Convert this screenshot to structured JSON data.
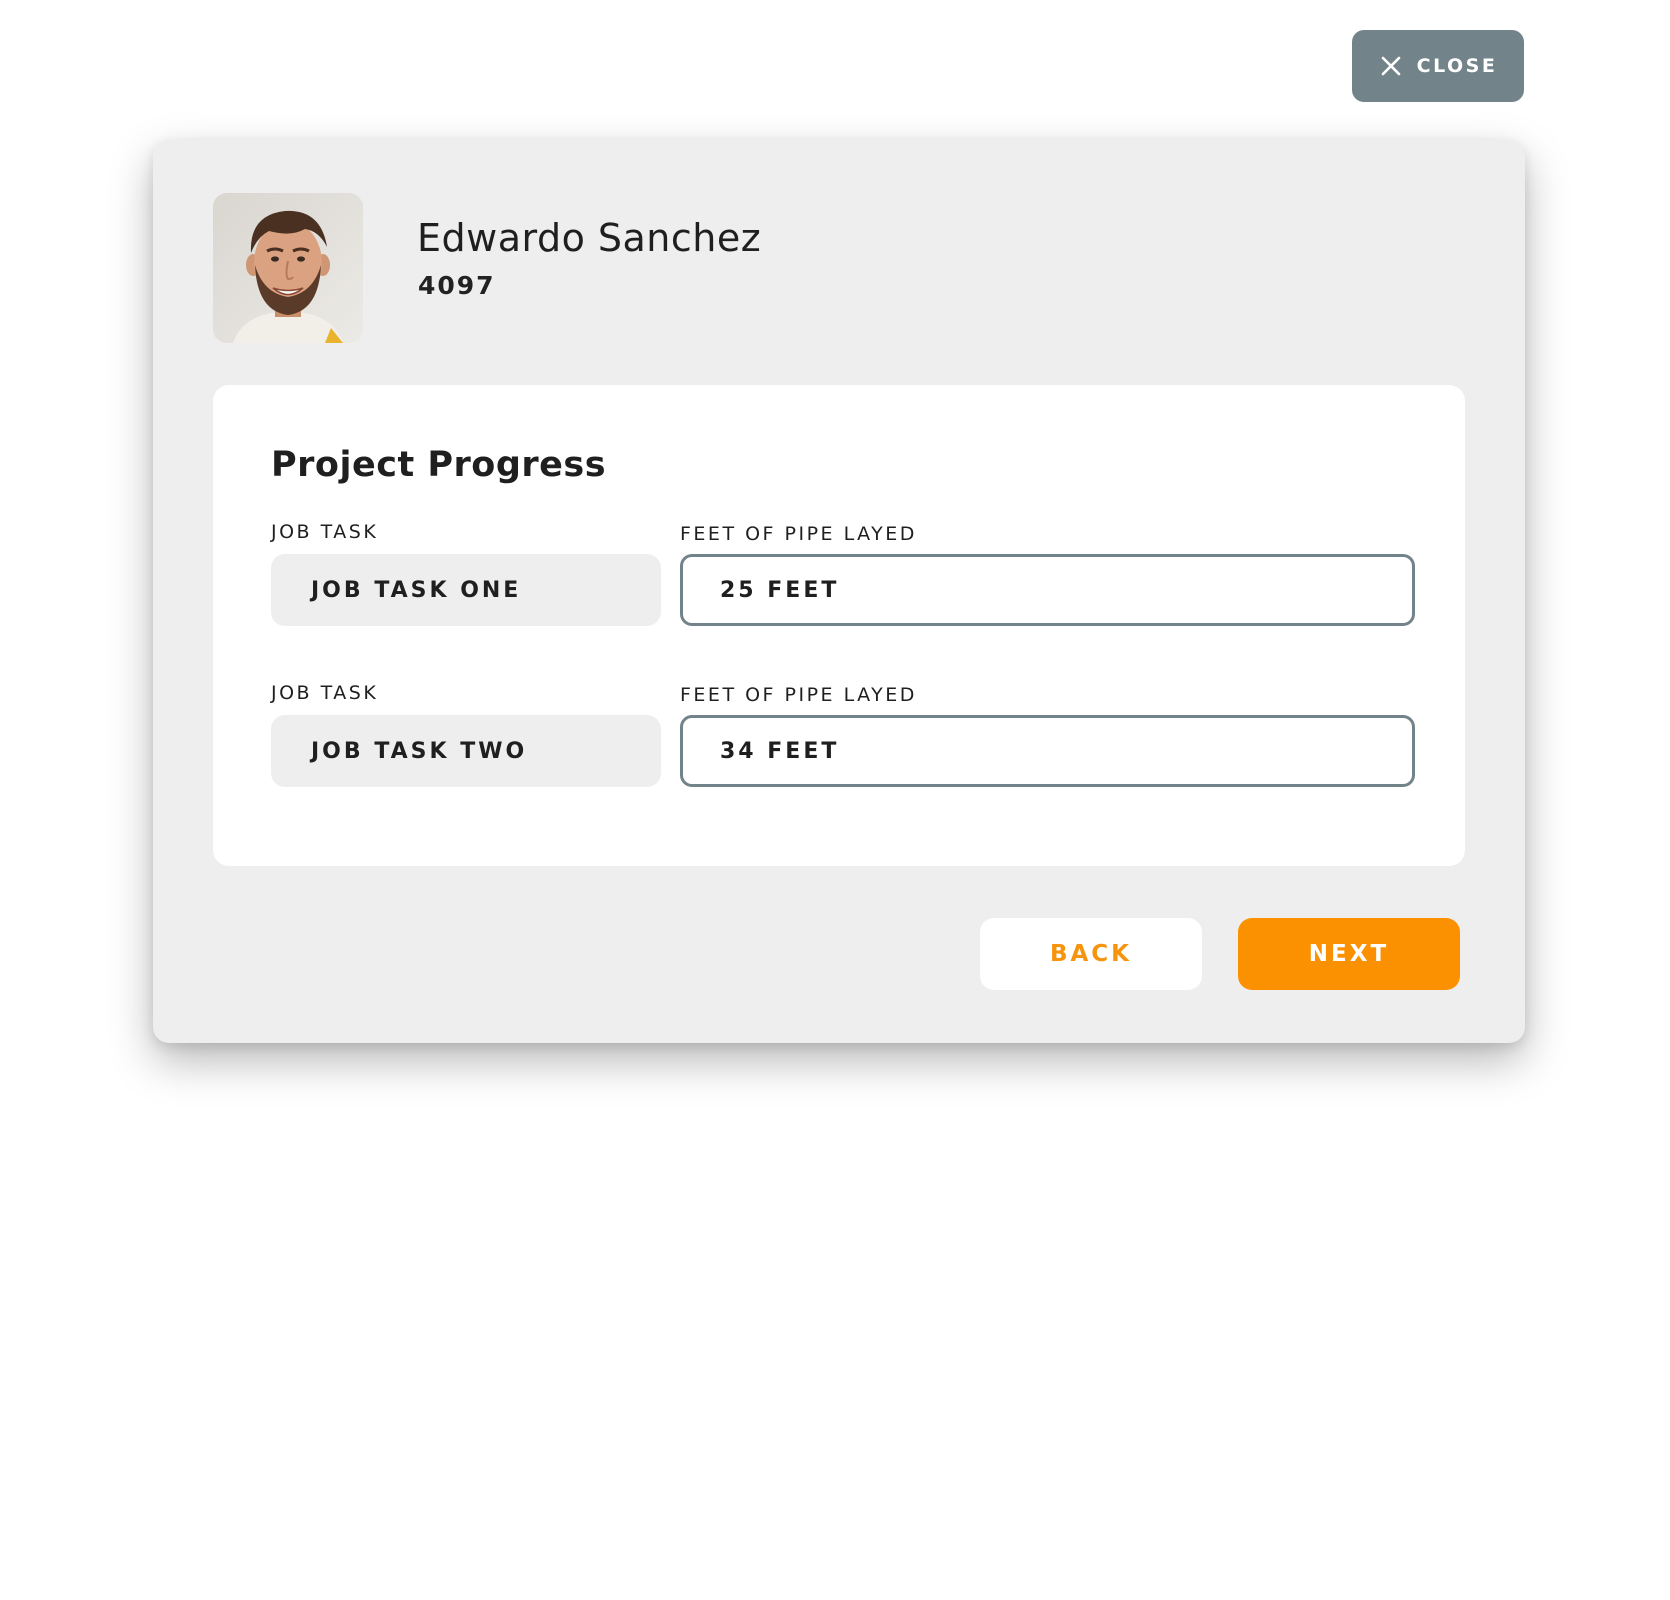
{
  "close_button": {
    "label": "CLOSE",
    "icon": "close-icon"
  },
  "profile": {
    "name": "Edwardo Sanchez",
    "id": "4097",
    "avatar": "avatar-photo"
  },
  "project_progress": {
    "title": "Project Progress",
    "rows": [
      {
        "task_label": "JOB TASK",
        "task_value": "JOB TASK ONE",
        "feet_label": "FEET OF PIPE LAYED",
        "feet_value": "25 FEET"
      },
      {
        "task_label": "JOB TASK",
        "task_value": "JOB TASK TWO",
        "feet_label": "FEET OF PIPE LAYED",
        "feet_value": "34 FEET"
      }
    ]
  },
  "footer": {
    "back_label": "BACK",
    "next_label": "NEXT"
  },
  "colors": {
    "accent_orange": "#fb9100",
    "slate": "#728489",
    "modal_bg": "#eeeeee",
    "card_bg": "#ffffff"
  }
}
